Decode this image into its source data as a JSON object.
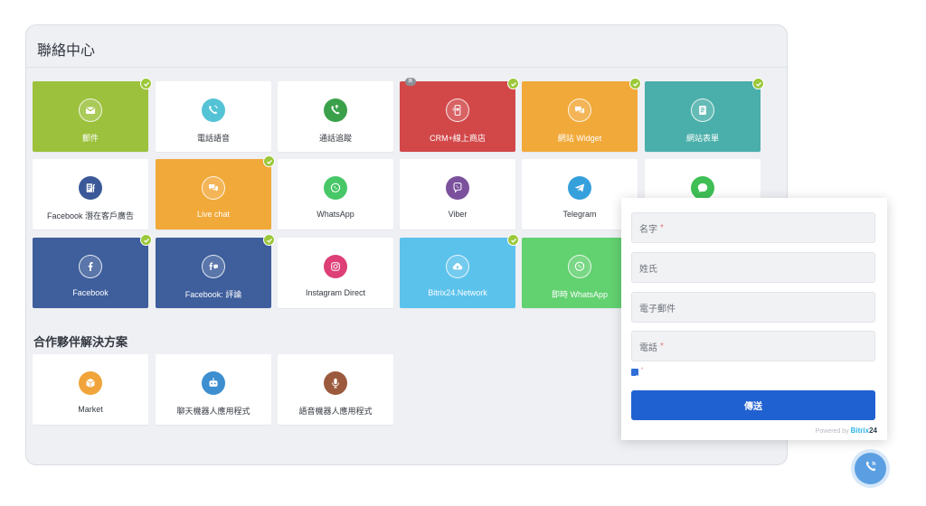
{
  "header": {
    "title": "聯絡中心"
  },
  "partners": {
    "title": "合作夥伴解決方案"
  },
  "tiles": [
    {
      "label": "郵件",
      "icon": "mail-icon",
      "bg": "#9cc13c",
      "icon_bg": "",
      "connected": true,
      "badge": ""
    },
    {
      "label": "電話語音",
      "icon": "phone-call-icon",
      "bg": "#ffffff",
      "icon_bg": "#55c3d6",
      "connected": false,
      "badge": ""
    },
    {
      "label": "通話追蹤",
      "icon": "call-tracking-icon",
      "bg": "#ffffff",
      "icon_bg": "#3aa14a",
      "connected": false,
      "badge": ""
    },
    {
      "label": "CRM+線上商店",
      "icon": "online-store-icon",
      "bg": "#d24849",
      "icon_bg": "",
      "connected": true,
      "badge": "新"
    },
    {
      "label": "網站 Widget",
      "icon": "chat-bubbles-icon",
      "bg": "#f1a93a",
      "icon_bg": "",
      "connected": true,
      "badge": ""
    },
    {
      "label": "網站表單",
      "icon": "form-icon",
      "bg": "#4aafaa",
      "icon_bg": "",
      "connected": true,
      "badge": ""
    },
    {
      "label": "Facebook 潛在客戶廣告",
      "icon": "facebook-lead-ads-icon",
      "bg": "#ffffff",
      "icon_bg": "#3b5998",
      "connected": false,
      "badge": ""
    },
    {
      "label": "Live chat",
      "icon": "live-chat-icon",
      "bg": "#f1a93a",
      "icon_bg": "",
      "connected": true,
      "badge": ""
    },
    {
      "label": "WhatsApp",
      "icon": "whatsapp-icon",
      "bg": "#ffffff",
      "icon_bg": "#47c767",
      "connected": false,
      "badge": ""
    },
    {
      "label": "Viber",
      "icon": "viber-icon",
      "bg": "#ffffff",
      "icon_bg": "#7b519d",
      "connected": false,
      "badge": ""
    },
    {
      "label": "Telegram",
      "icon": "telegram-icon",
      "bg": "#ffffff",
      "icon_bg": "#35a0dc",
      "connected": false,
      "badge": ""
    },
    {
      "label": "",
      "icon": "messenger-bubble-icon",
      "bg": "#ffffff",
      "icon_bg": "#3fbf55",
      "connected": false,
      "badge": ""
    },
    {
      "label": "Facebook",
      "icon": "facebook-icon",
      "bg": "#3e5e9c",
      "icon_bg": "",
      "connected": true,
      "badge": ""
    },
    {
      "label": "Facebook: 評論",
      "icon": "facebook-comments-icon",
      "bg": "#3e5e9c",
      "icon_bg": "",
      "connected": true,
      "badge": ""
    },
    {
      "label": "Instagram Direct",
      "icon": "instagram-icon",
      "bg": "#ffffff",
      "icon_bg": "#dd3f76",
      "connected": false,
      "badge": ""
    },
    {
      "label": "Bitrix24.Network",
      "icon": "cloud-icon",
      "bg": "#5bc2ec",
      "icon_bg": "",
      "connected": true,
      "badge": ""
    },
    {
      "label": "即時 WhatsApp",
      "icon": "whatsapp-icon",
      "bg": "#62d170",
      "icon_bg": "",
      "connected": false,
      "badge": ""
    },
    {
      "label": "Market",
      "icon": "market-box-icon",
      "bg": "#ffffff",
      "icon_bg": "#f0a43a",
      "connected": false,
      "badge": ""
    },
    {
      "label": "聊天機器人應用程式",
      "icon": "chatbot-icon",
      "bg": "#ffffff",
      "icon_bg": "#3d8fd0",
      "connected": false,
      "badge": ""
    },
    {
      "label": "語音機器人應用程式",
      "icon": "microphone-icon",
      "bg": "#ffffff",
      "icon_bg": "#9b5a3d",
      "connected": false,
      "badge": ""
    }
  ],
  "form": {
    "fields": [
      {
        "placeholder": "名字",
        "required": true
      },
      {
        "placeholder": "姓氏",
        "required": false
      },
      {
        "placeholder": "電子郵件",
        "required": false
      },
      {
        "placeholder": "電話",
        "required": true
      }
    ],
    "consent_checked": true,
    "submit_label": "傳送",
    "powered_prefix": "Powered by",
    "powered_brand": "Bitrix",
    "powered_brand_num": "24"
  },
  "call_widget": {
    "icon": "phone-call-icon",
    "color": "#5b9fe2"
  }
}
